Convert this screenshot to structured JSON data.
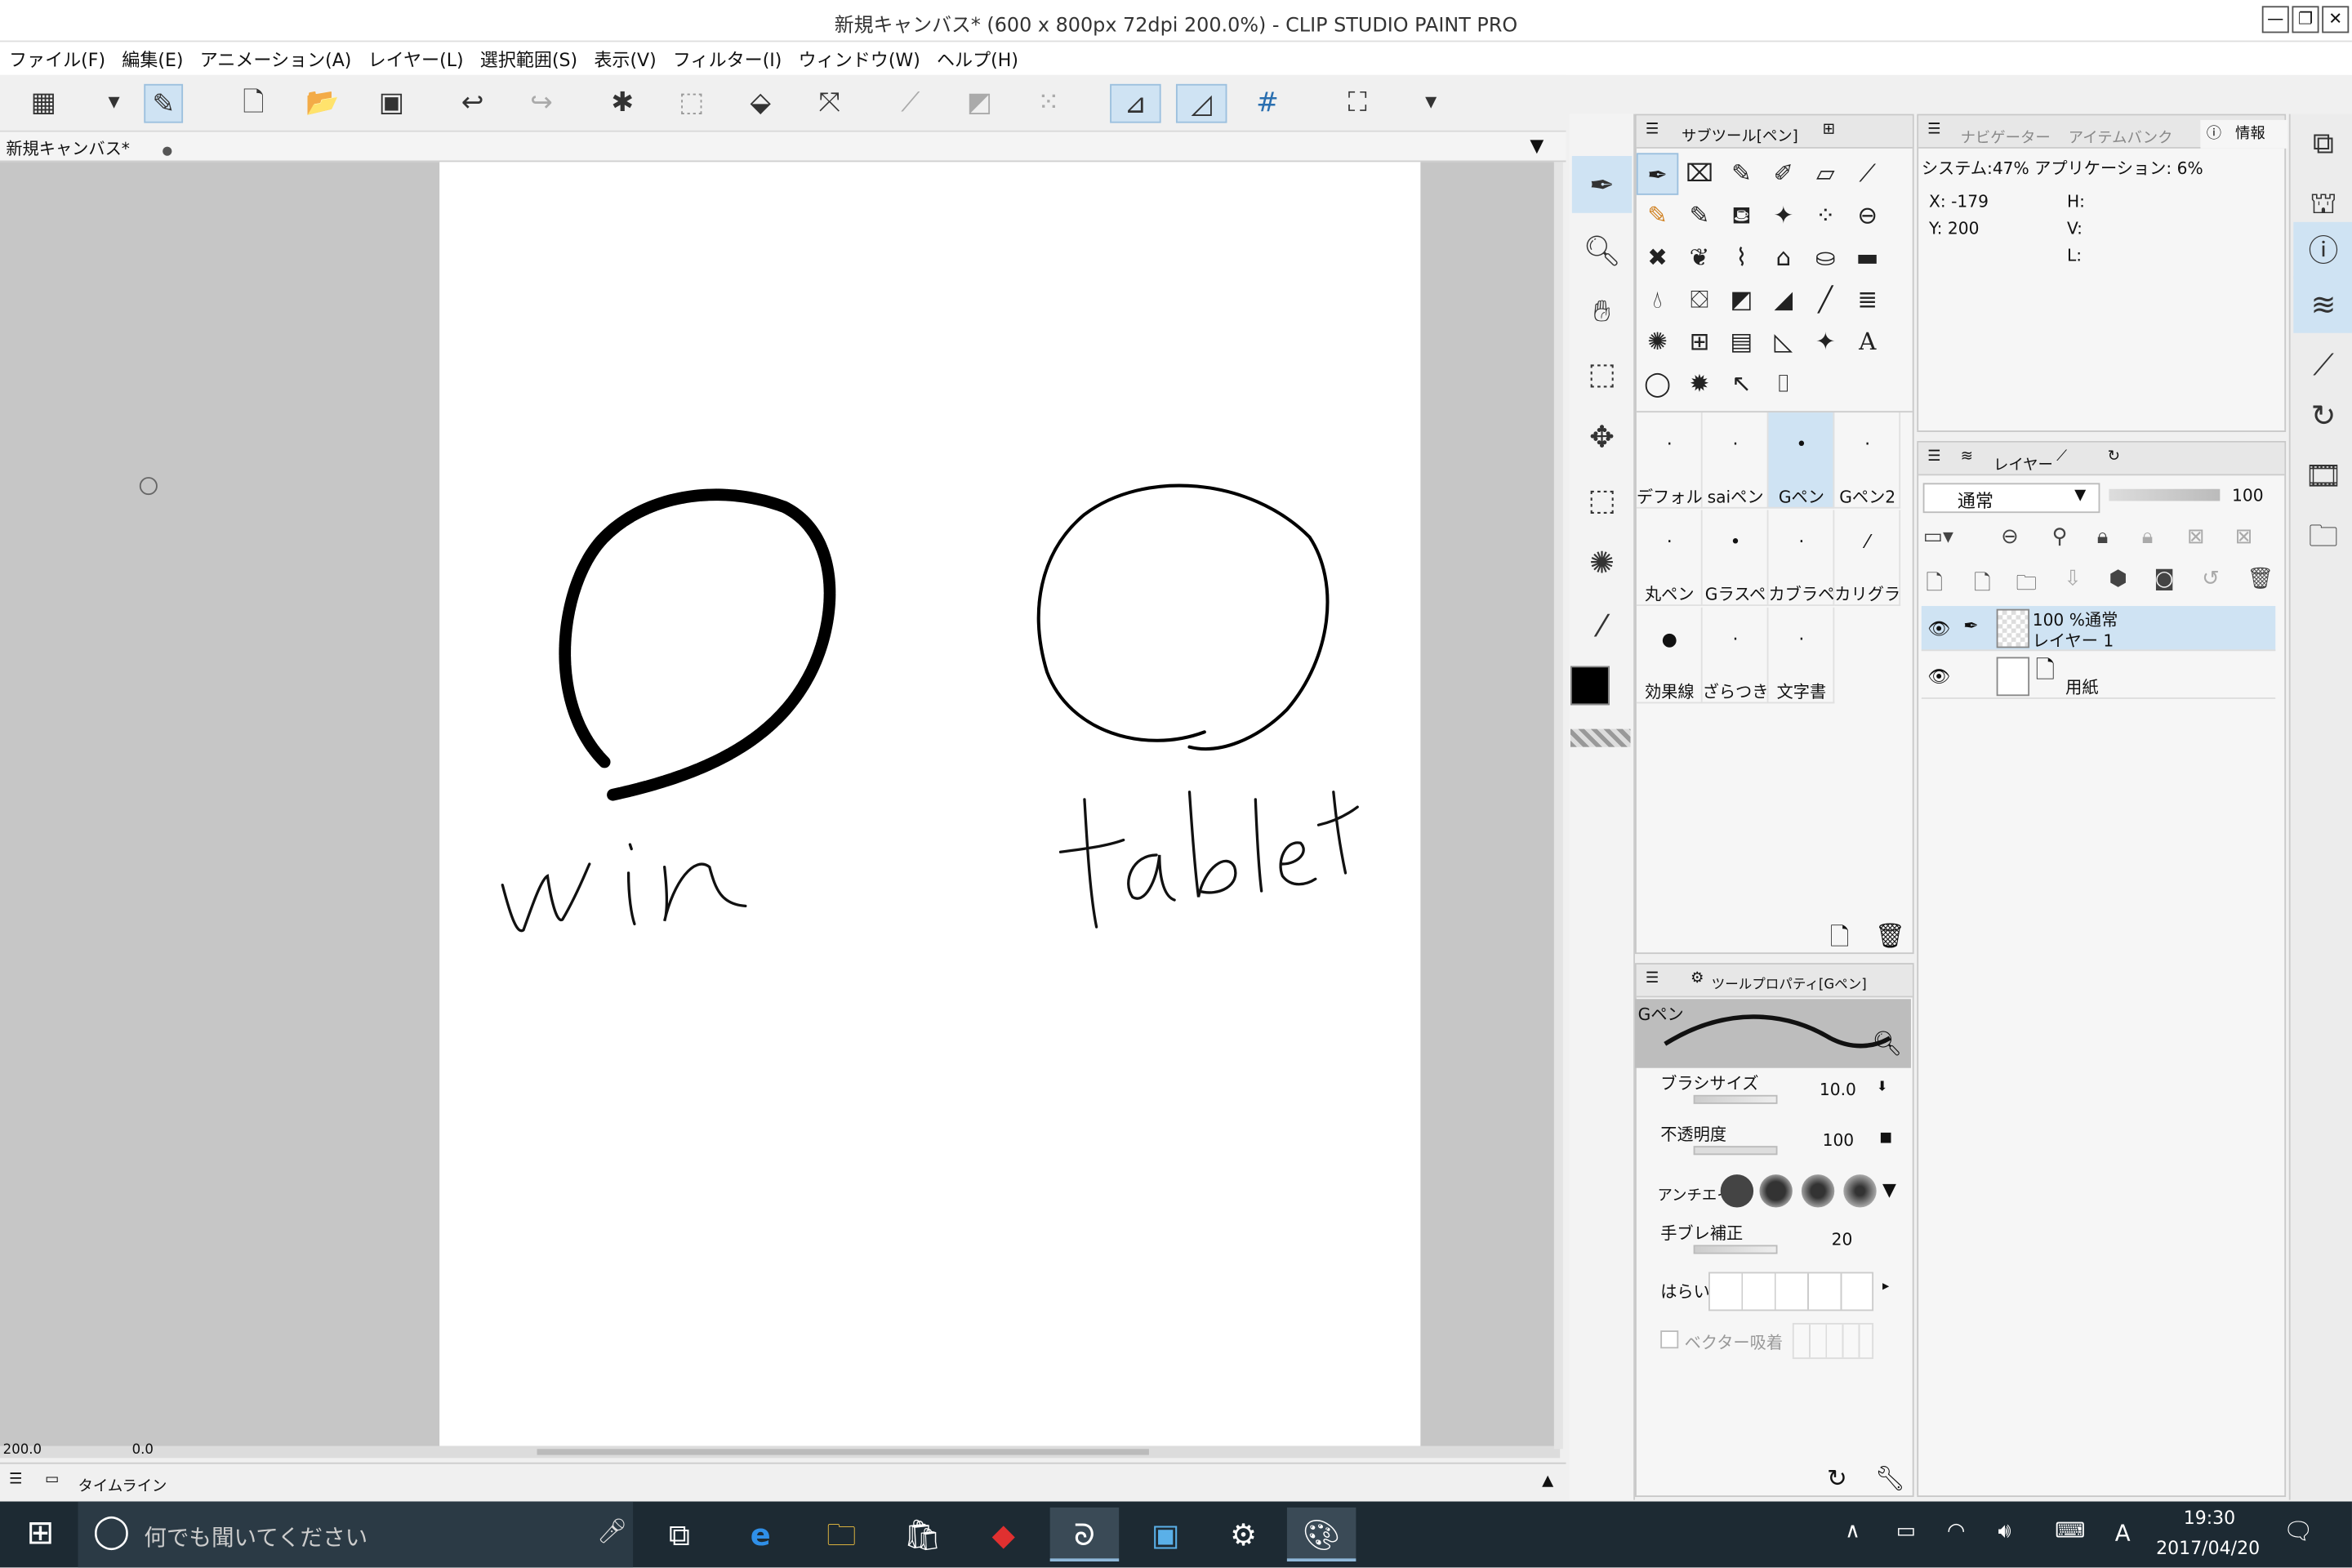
{
  "window": {
    "title": "新規キャンバス* (600 x 800px 72dpi 200.0%)  - CLIP STUDIO PAINT PRO",
    "min_label": "—",
    "max_label": "❐",
    "close_label": "✕"
  },
  "menu": [
    "ファイル(F)",
    "編集(E)",
    "アニメーション(A)",
    "レイヤー(L)",
    "選択範囲(S)",
    "表示(V)",
    "フィルター(I)",
    "ウィンドウ(W)",
    "ヘルプ(H)"
  ],
  "canvas_tab": {
    "label": "新規キャンバス*",
    "dot": "●"
  },
  "canvas": {
    "text_left": "win",
    "text_right": "tablet"
  },
  "status": {
    "zoom": "200.0",
    "angle": "0.0"
  },
  "timeline_label": "タイムライン",
  "subtool_panel": {
    "title": "サブツール[ペン]"
  },
  "brushes": [
    {
      "label": "デフォル",
      "dot": "·",
      "active": false
    },
    {
      "label": "saiペン",
      "dot": "·",
      "active": false
    },
    {
      "label": "Gペン",
      "dot": "•",
      "active": true
    },
    {
      "label": "Gペン2",
      "dot": "·",
      "active": false
    },
    {
      "label": "丸ペン",
      "dot": "·",
      "active": false
    },
    {
      "label": "Gラスペ",
      "dot": "•",
      "active": false
    },
    {
      "label": "カブラペ",
      "dot": "·",
      "active": false
    },
    {
      "label": "カリグラフ",
      "dot": "⁄",
      "active": false
    },
    {
      "label": "効果線",
      "dot": "●",
      "active": false
    },
    {
      "label": "ざらつき",
      "dot": "·",
      "active": false
    },
    {
      "label": "文字書",
      "dot": "·",
      "active": false
    }
  ],
  "tool_property": {
    "title": "ツールプロパティ[Gペン]",
    "preview_label": "Gペン",
    "brush_size_label": "ブラシサイズ",
    "brush_size_value": "10.0",
    "opacity_label": "不透明度",
    "opacity_value": "100",
    "antialias_label": "アンチエイ",
    "stabilizer_label": "手ブレ補正",
    "stabilizer_value": "20",
    "taper_label": "はらい",
    "vector_label": "ベクター吸着"
  },
  "info_panel": {
    "tabs": [
      "ナビゲーター",
      "アイテムバンク",
      "情報"
    ],
    "system": "システム:47% アプリケーション: 6%",
    "x": "X: -179",
    "y": "Y: 200",
    "h": "H:",
    "v": "V:",
    "l": "L:"
  },
  "layer_panel": {
    "tab": "レイヤー",
    "blend_mode": "通常",
    "opacity": "100",
    "layers": [
      {
        "line1": "100 %通常",
        "line2": "レイヤー 1",
        "selected": true
      },
      {
        "line1": "",
        "line2": "用紙",
        "selected": false
      }
    ]
  },
  "taskbar": {
    "search_placeholder": "何でも聞いてください",
    "time": "19:30",
    "date": "2017/04/20",
    "ime": "A"
  }
}
